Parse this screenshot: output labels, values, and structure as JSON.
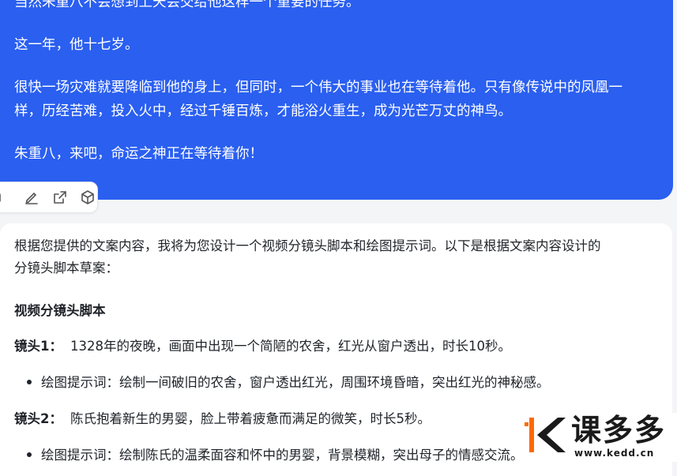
{
  "user_message": {
    "lines": [
      "当然朱重八不会想到上天会交给他这样一个重要的任务。",
      "这一年，他十七岁。",
      "很快一场灾难就要降临到他的身上，但同时，一个伟大的事业也在等待着他。只有像传说中的凤凰一",
      "样，历经苦难，投入火中，经过千锤百炼，才能浴火重生，成为光芒万丈的神鸟。",
      "朱重八，来吧，命运之神正在等待着你！"
    ],
    "bubble_color": "#2a5ff0"
  },
  "actions": {
    "icons": [
      "copy-icon",
      "edit-icon",
      "share-icon",
      "cube-icon"
    ]
  },
  "reply": {
    "intro_line1": "根据您提供的文案内容，我将为您设计一个视频分镜头脚本和绘图提示词。以下是根据文案内容设计的",
    "intro_line2": "分镜头脚本草案：",
    "heading": "视频分镜头脚本",
    "shots": [
      {
        "label": "镜头1：",
        "text": "1328年的夜晚，画面中出现一个简陋的农舍，红光从窗户透出，时长10秒。",
        "prompt": "绘图提示词：绘制一间破旧的农舍，窗户透出红光，周围环境昏暗，突出红光的神秘感。"
      },
      {
        "label": "镜头2：",
        "text": "陈氏抱着新生的男婴，脸上带着疲惫而满足的微笑，时长5秒。",
        "prompt": "绘图提示词：绘制陈氏的温柔面容和怀中的男婴，背景模糊，突出母子的情感交流。"
      }
    ]
  },
  "watermark": {
    "brand": "课多多",
    "url": "www.kedd.cn",
    "colors": {
      "accent": "#ff6a00",
      "dark": "#1a1a1a"
    }
  }
}
